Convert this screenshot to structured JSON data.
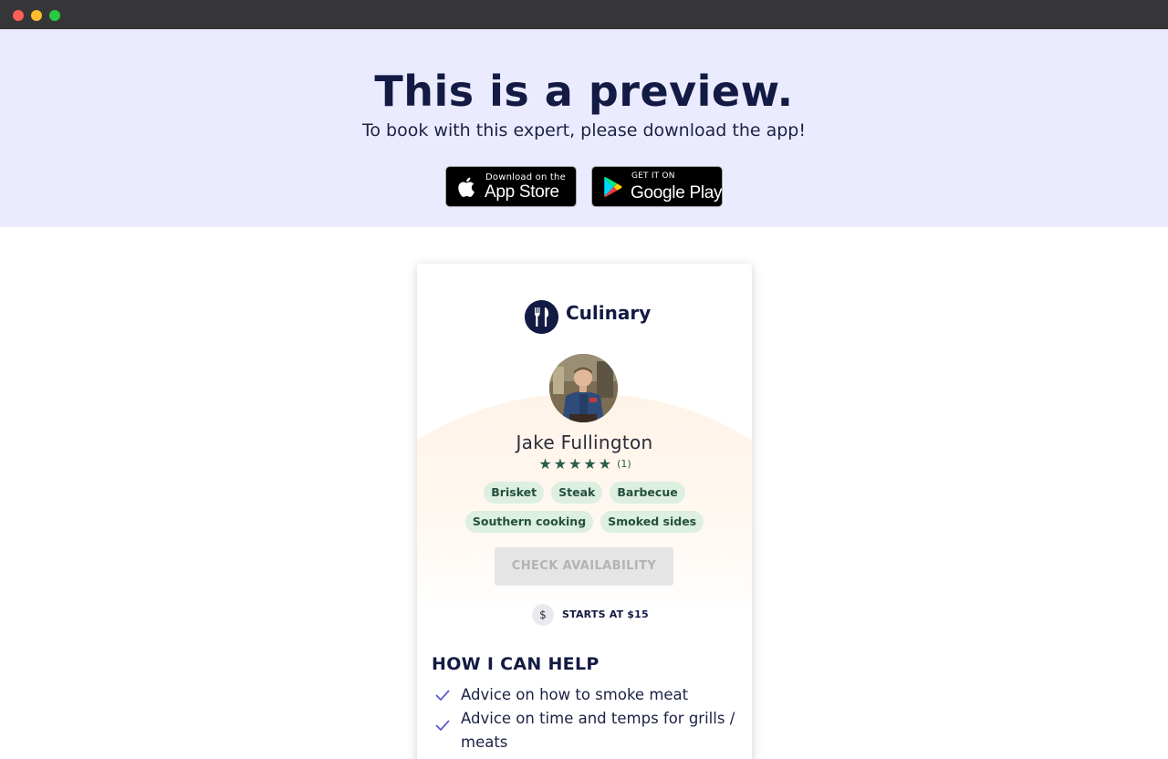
{
  "window": {
    "controls": [
      "close",
      "minimize",
      "maximize"
    ]
  },
  "banner": {
    "title": "This is a preview.",
    "subtitle": "To book with this expert, please download the app!",
    "app_store": {
      "small": "Download on the",
      "big": "App Store",
      "icon": "apple-icon"
    },
    "google_play": {
      "small": "GET IT ON",
      "big": "Google Play",
      "icon": "google-play-icon"
    }
  },
  "card": {
    "category": {
      "label": "Culinary",
      "icon": "fork-knife-icon"
    },
    "expert": {
      "name": "Jake Fullington"
    },
    "rating": {
      "stars": 5,
      "star_glyph": "★",
      "count": "(1)"
    },
    "tags_row1": [
      "Brisket",
      "Steak",
      "Barbecue"
    ],
    "tags_row2": [
      "Southern cooking",
      "Smoked sides"
    ],
    "check_button": "CHECK AVAILABILITY",
    "price": {
      "icon_text": "$",
      "label": "STARTS AT $15"
    },
    "help": {
      "title": "HOW I CAN HELP",
      "items": [
        "Advice on how to smoke meat",
        "Advice on time and temps for grills / meats"
      ]
    }
  },
  "colors": {
    "banner_bg": "#ebebff",
    "navy": "#131a43",
    "tag_bg": "#dcefe0",
    "tag_text": "#25503f",
    "star": "#2a5c4b",
    "check": "#5b5bd6"
  }
}
